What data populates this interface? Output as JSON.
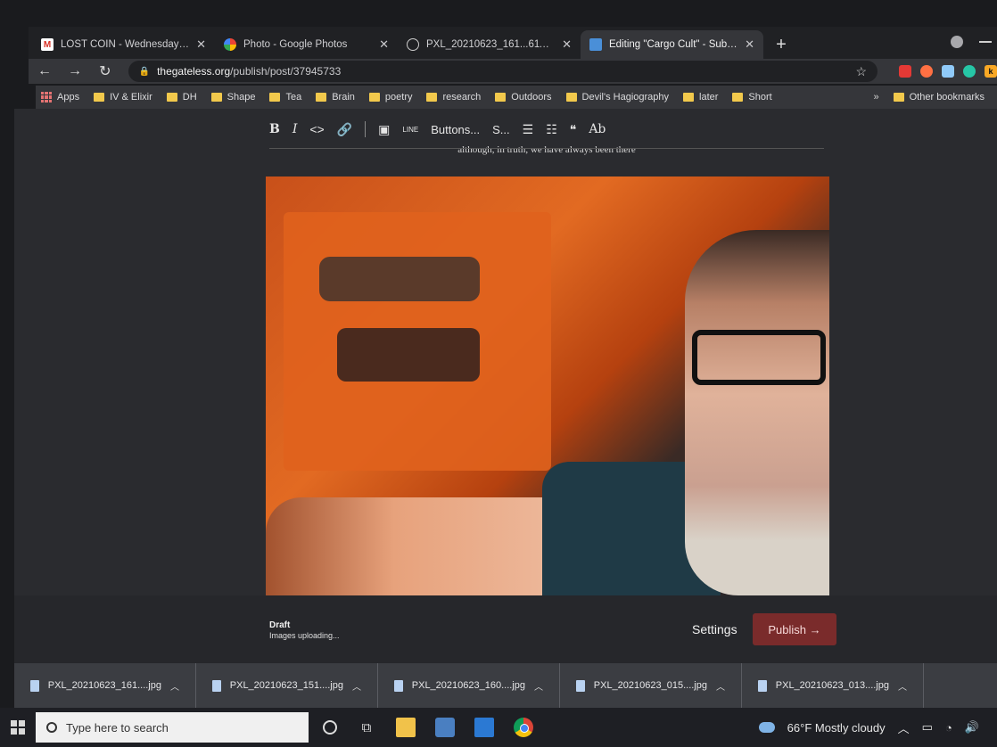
{
  "browser": {
    "tabs": [
      {
        "title": "LOST COIN - Wednesday Mornin",
        "favicon": "gmail-icon",
        "active": false
      },
      {
        "title": "Photo - Google Photos",
        "favicon": "google-photos-icon",
        "active": false
      },
      {
        "title": "PXL_20210623_161...611.MP.jp",
        "favicon": "globe-icon",
        "active": false
      },
      {
        "title": "Editing \"Cargo Cult\" - Substack",
        "favicon": "substack-icon",
        "active": true
      }
    ],
    "url_host": "thegateless.org",
    "url_path": "/publish/post/37945733",
    "bookmarks": [
      "Apps",
      "IV & Elixir",
      "DH",
      "Shape",
      "Tea",
      "Brain",
      "poetry",
      "research",
      "Outdoors",
      "Devil's Hagiography",
      "later",
      "Short"
    ],
    "other_bookmarks": "Other bookmarks",
    "more": "»"
  },
  "editor": {
    "toolbar": {
      "bold": "B",
      "italic": "I",
      "code": "<>",
      "link": "🔗",
      "image": "▣",
      "line": "LINE",
      "buttons": "Buttons...",
      "style": "S...",
      "bullets": "☰",
      "numbers": "☷",
      "quote": "❝",
      "text_style": "Ab"
    },
    "body_text": "although, in truth, we have always been there",
    "status_title": "Draft",
    "status_detail": "Images uploading...",
    "settings_label": "Settings",
    "publish_label": "Publish →"
  },
  "downloads": [
    {
      "name": "PXL_20210623_161....jpg"
    },
    {
      "name": "PXL_20210623_151....jpg"
    },
    {
      "name": "PXL_20210623_160....jpg"
    },
    {
      "name": "PXL_20210623_015....jpg"
    },
    {
      "name": "PXL_20210623_013....jpg"
    }
  ],
  "taskbar": {
    "search_placeholder": "Type here to search",
    "weather": "66°F  Mostly cloudy"
  },
  "colors": {
    "publish": "#7a2b2b",
    "chrome_dark": "#202124"
  }
}
